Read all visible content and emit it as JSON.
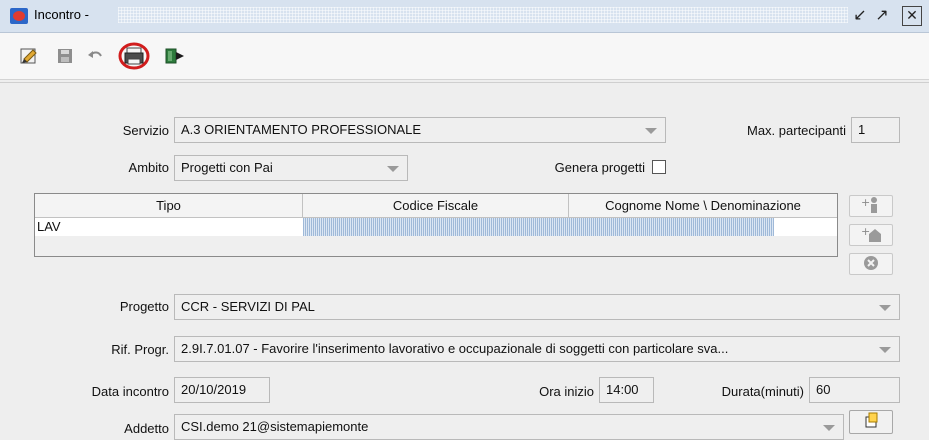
{
  "window": {
    "title": "Incontro -",
    "icons": {
      "app": "app-icon",
      "minimize": "minimize-icon",
      "maximize": "maximize-icon",
      "close": "close-icon"
    }
  },
  "toolbar": {
    "items": [
      {
        "name": "edit-icon"
      },
      {
        "name": "save-icon"
      },
      {
        "name": "undo-icon"
      },
      {
        "name": "print-icon",
        "highlight": "#d11d1d"
      },
      {
        "name": "exit-icon"
      }
    ]
  },
  "form": {
    "servizio": {
      "label": "Servizio",
      "value": "A.3 ORIENTAMENTO PROFESSIONALE"
    },
    "max_partecipanti": {
      "label": "Max. partecipanti",
      "value": "1"
    },
    "ambito": {
      "label": "Ambito",
      "value": "Progetti con Pai"
    },
    "genera_progetti": {
      "label": "Genera progetti",
      "checked": false
    },
    "progetto": {
      "label": "Progetto",
      "value": "CCR - SERVIZI DI PAL"
    },
    "rif_progr": {
      "label": "Rif. Progr.",
      "value": "2.9I.7.01.07 - Favorire l'inserimento lavorativo e occupazionale di soggetti con particolare sva..."
    },
    "data_incontro": {
      "label": "Data incontro",
      "value": "20/10/2019"
    },
    "ora_inizio": {
      "label": "Ora inizio",
      "value": "14:00"
    },
    "durata": {
      "label": "Durata(minuti)",
      "value": "60"
    },
    "addetto": {
      "label": "Addetto",
      "value": "CSI.demo 21@sistemapiemonte"
    }
  },
  "table": {
    "columns": [
      "Tipo",
      "Codice Fiscale",
      "Cognome Nome \\ Denominazione"
    ],
    "rows": [
      {
        "tipo": "LAV",
        "codice_fiscale": "",
        "nome": ""
      }
    ],
    "side_buttons": [
      "add-person-icon",
      "add-company-icon",
      "remove-icon"
    ]
  },
  "colors": {
    "titlebar": "#d7e2ef",
    "highlight_circle": "#d11d1d",
    "field_bg": "#efefef"
  }
}
